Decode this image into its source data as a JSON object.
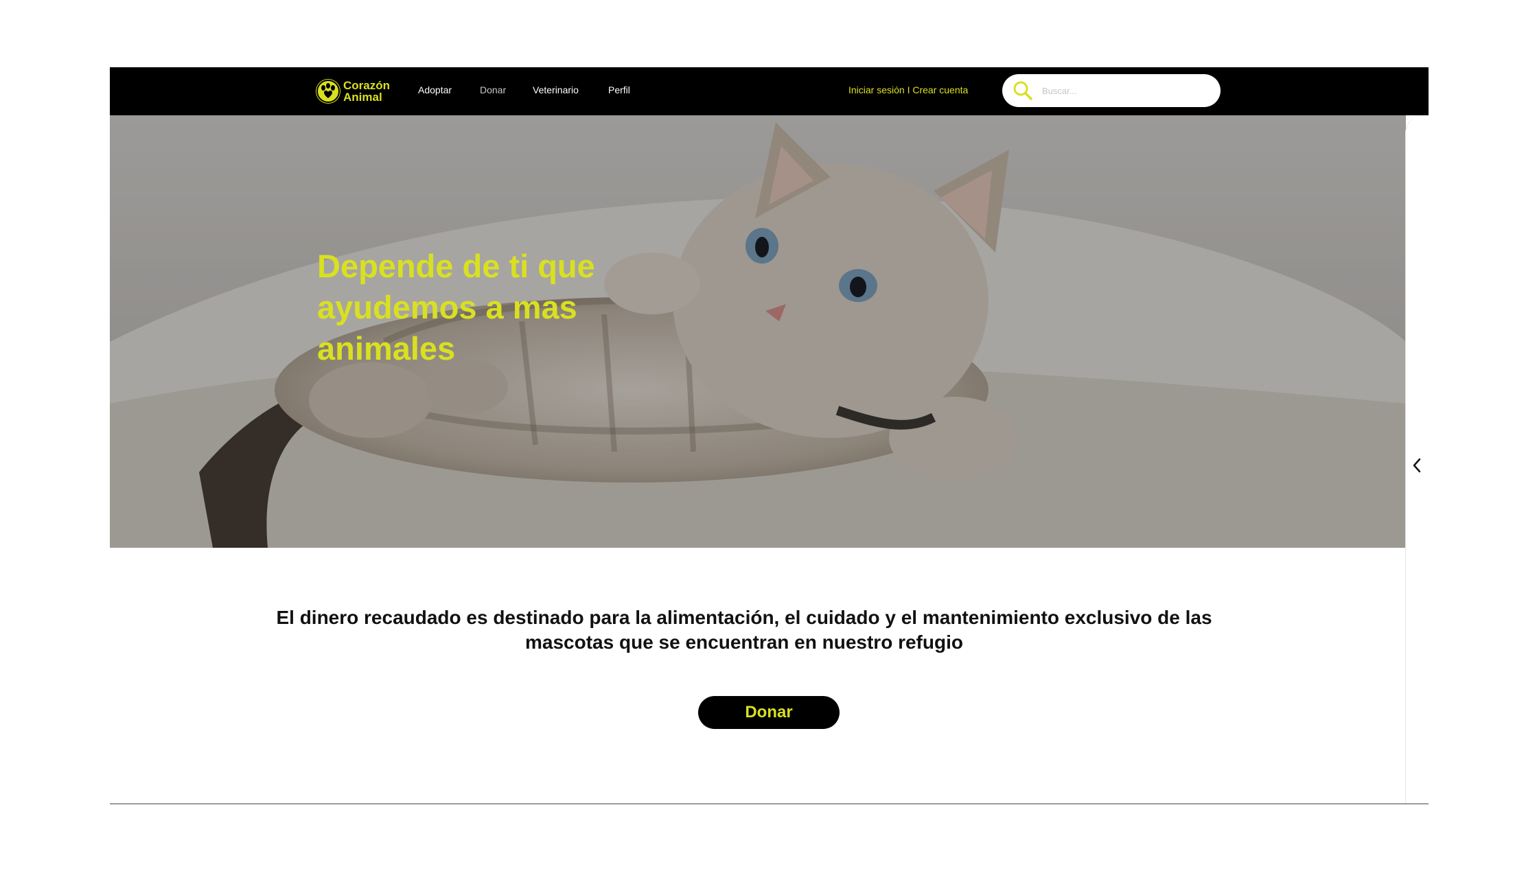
{
  "brand": {
    "line1": "Corazón",
    "line2": "Animal",
    "accent_color": "#d9e021"
  },
  "nav": {
    "items": [
      {
        "label": "Adoptar"
      },
      {
        "label": "Donar"
      },
      {
        "label": "Veterinario"
      },
      {
        "label": "Perfil"
      }
    ],
    "auth_links": "Iniciar sesión I Crear cuenta"
  },
  "search": {
    "placeholder": "Buscar..."
  },
  "hero": {
    "title": "Depende de ti que ayudemos a mas animales",
    "image": "kitten lying on white fluffy blanket"
  },
  "info": {
    "text": "El dinero recaudado es destinado para la alimentación, el cuidado y el mantenimiento exclusivo de las mascotas que se encuentran en nuestro refugio"
  },
  "cta": {
    "label": "Donar"
  },
  "side_panel": {
    "icon": "chevron-left-icon"
  }
}
